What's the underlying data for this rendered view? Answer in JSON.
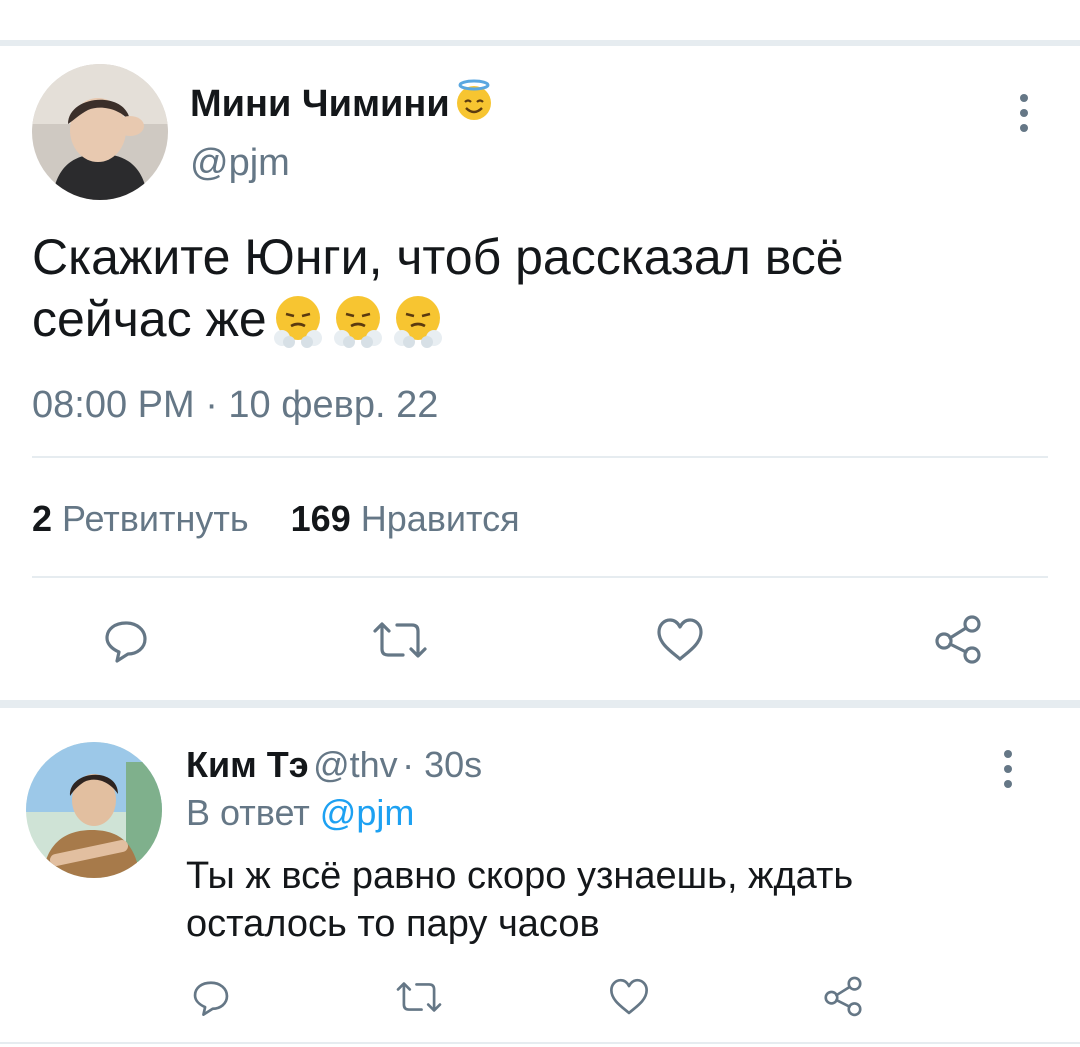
{
  "colors": {
    "text": "#14171a",
    "secondary": "#657786",
    "link": "#1da1f2",
    "divider": "#e6ecf0"
  },
  "tweet": {
    "author_name": "Мини Чимини",
    "author_emoji": "smiling-face-with-halo-icon",
    "handle": "@pjm",
    "text_line1": "Скажите Юнги, чтоб рассказал всё",
    "text_line2": "сейчас же",
    "text_emojis": [
      "face-with-steam-from-nose-icon",
      "face-with-steam-from-nose-icon",
      "face-with-steam-from-nose-icon"
    ],
    "timestamp": "08:00 PM · 10 февр. 22",
    "retweet_count": "2",
    "retweet_label": "Ретвитнуть",
    "like_count": "169",
    "like_label": "Нравится",
    "actions": [
      "reply-icon",
      "retweet-icon",
      "like-icon",
      "share-icon"
    ]
  },
  "reply": {
    "author_name": "Ким Тэ",
    "handle": "@thv",
    "time": "· 30s",
    "reply_to_prefix": "В ответ",
    "reply_to_handle": "@pjm",
    "text_line1": "Ты ж всё равно скоро узнаешь, ждать",
    "text_line2": "осталось то пару часов",
    "actions": [
      "reply-icon",
      "retweet-icon",
      "like-icon",
      "share-icon"
    ]
  }
}
